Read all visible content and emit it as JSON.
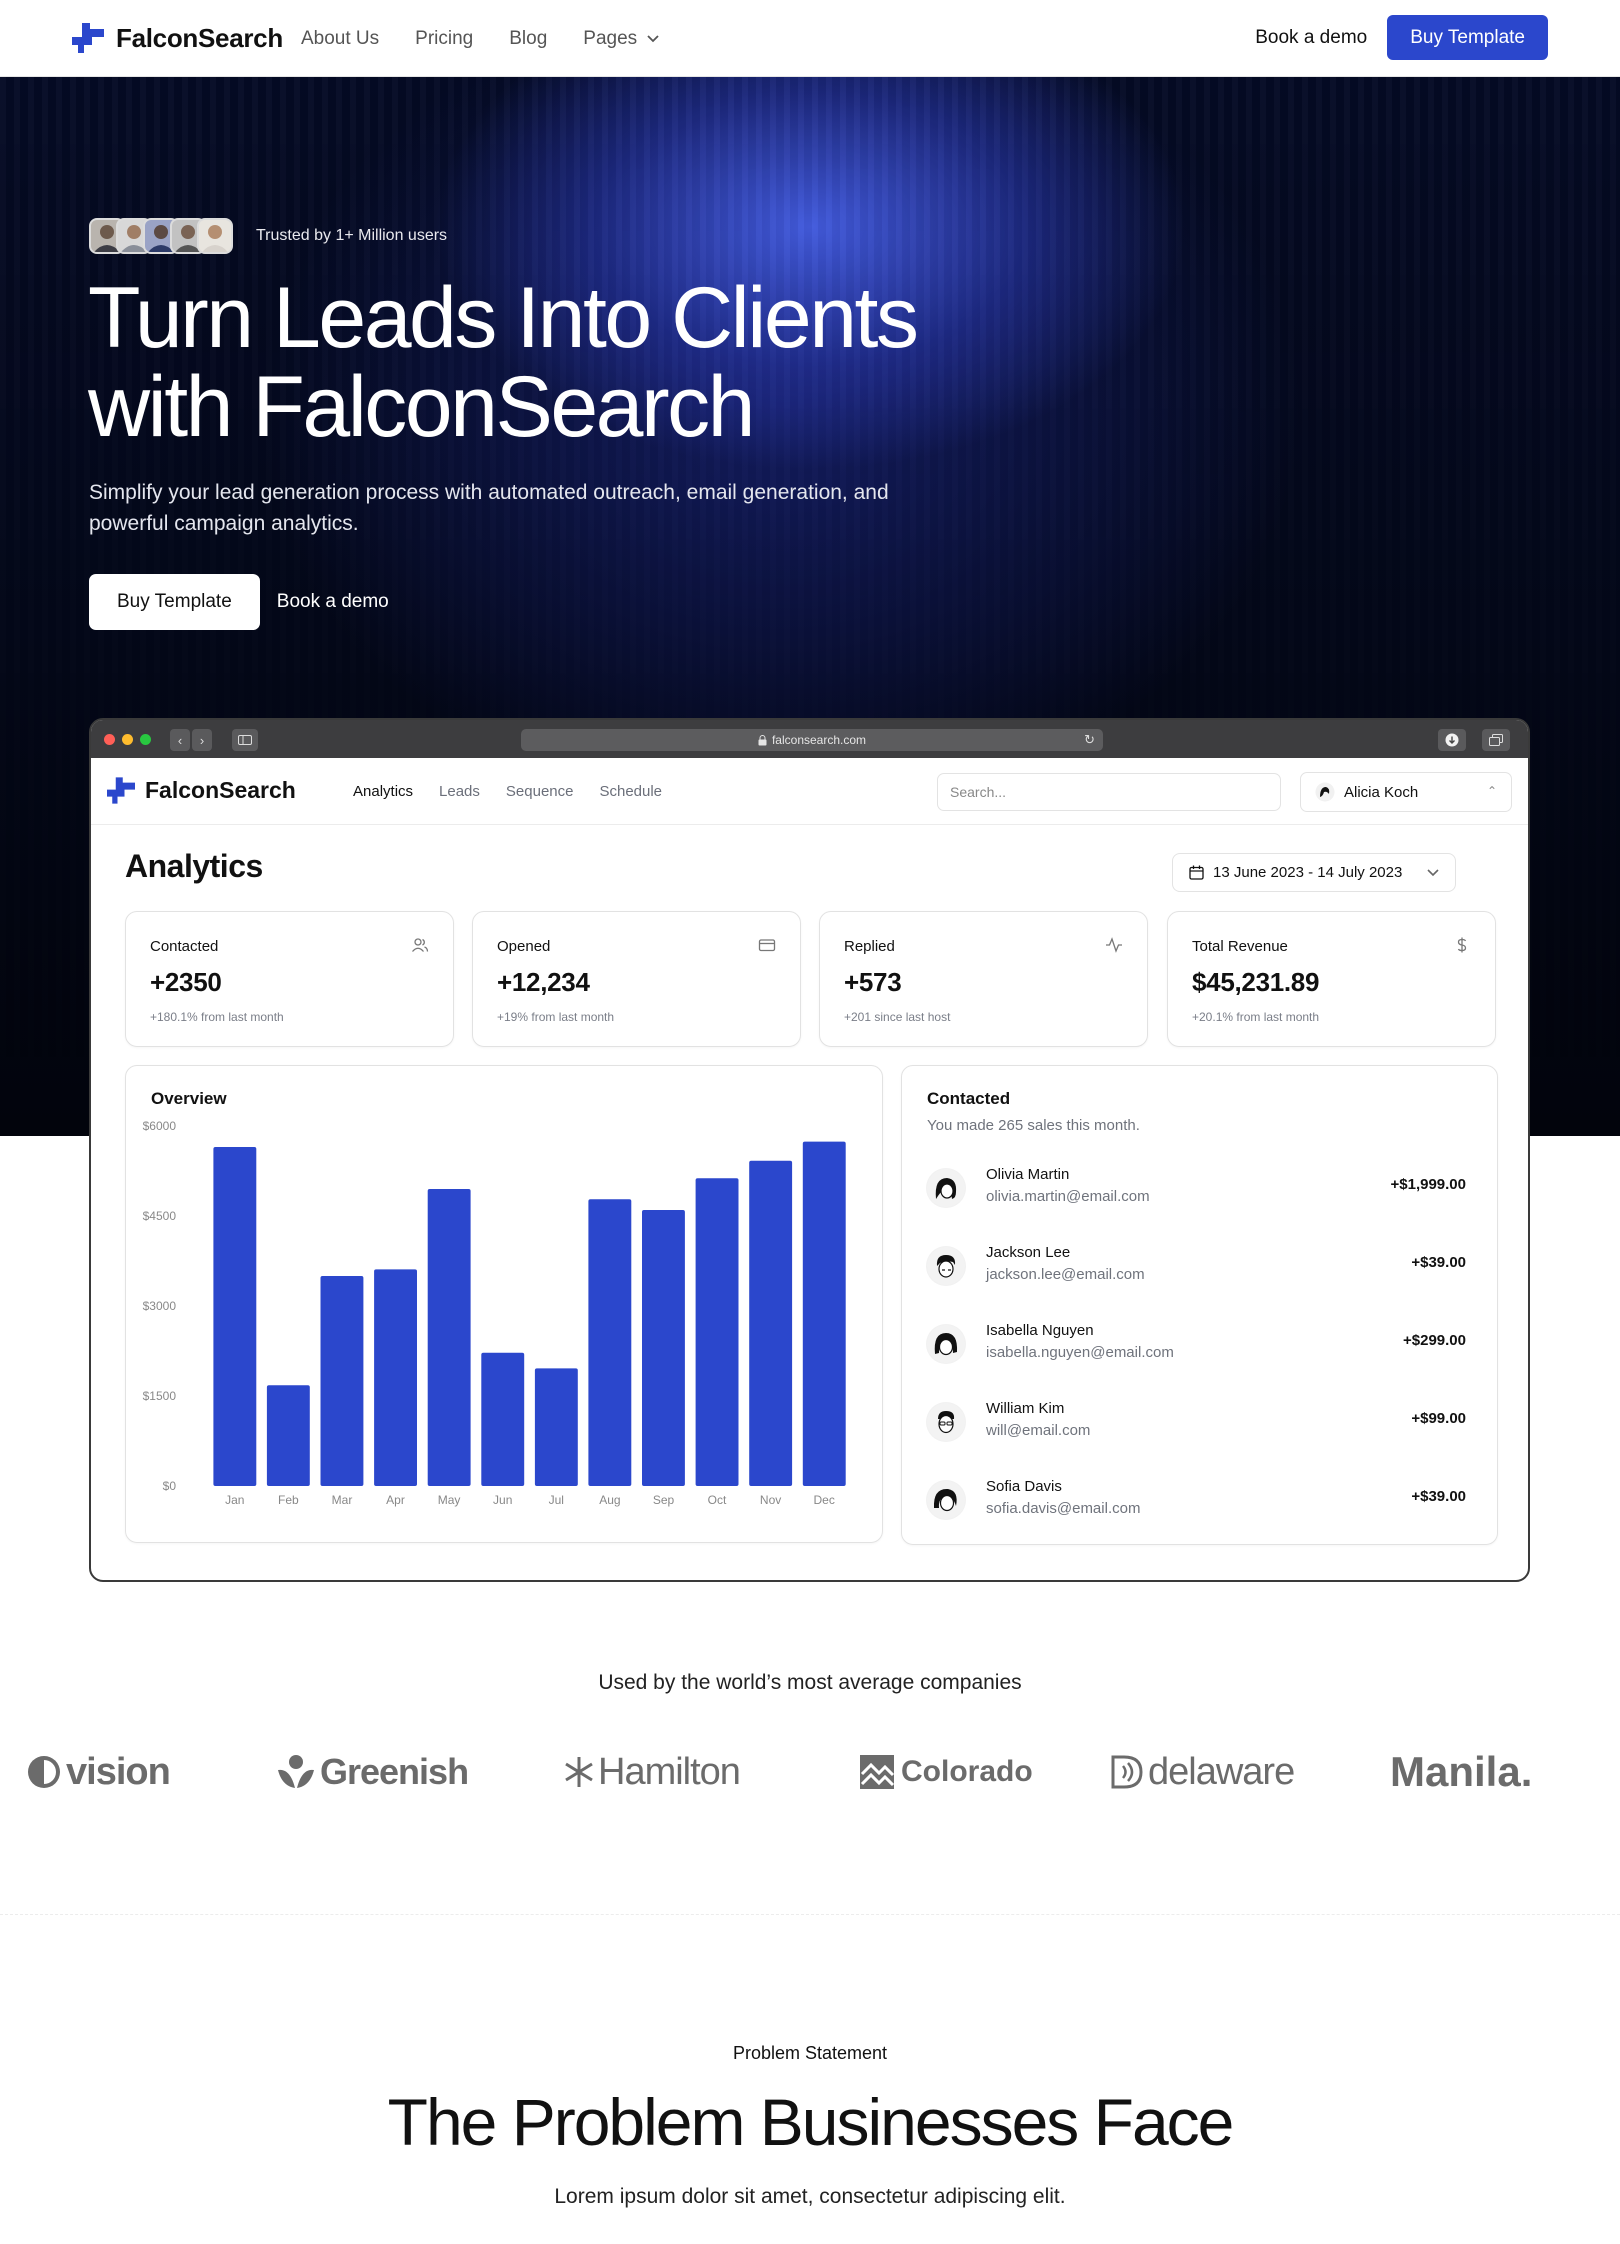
{
  "nav": {
    "brand": "FalconSearch",
    "links": [
      "About Us",
      "Pricing",
      "Blog",
      "Pages"
    ],
    "book_demo": "Book a demo",
    "buy_template": "Buy Template"
  },
  "hero": {
    "trusted_text": "Trusted by 1+ Million users",
    "title_line1": "Turn Leads Into Clients",
    "title_line2": "with FalconSearch",
    "subtitle": "Simplify your lead generation process with automated outreach, email generation, and powerful campaign analytics.",
    "buy_template": "Buy Template",
    "book_demo": "Book a demo"
  },
  "browser": {
    "url": "falconsearch.com"
  },
  "app": {
    "brand": "FalconSearch",
    "tabs": [
      "Analytics",
      "Leads",
      "Sequence",
      "Schedule"
    ],
    "search_placeholder": "Search...",
    "user_name": "Alicia Koch",
    "page_title": "Analytics",
    "date_range": "13 June 2023 - 14 July 2023",
    "stats": [
      {
        "label": "Contacted",
        "value": "+2350",
        "sub": "+180.1% from last month",
        "icon": "users-icon"
      },
      {
        "label": "Opened",
        "value": "+12,234",
        "sub": "+19% from last month",
        "icon": "credit-card-icon"
      },
      {
        "label": "Replied",
        "value": "+573",
        "sub": "+201 since last host",
        "icon": "activity-icon"
      },
      {
        "label": "Total Revenue",
        "value": "$45,231.89",
        "sub": "+20.1% from last month",
        "icon": "dollar-icon"
      }
    ],
    "overview_title": "Overview",
    "contacted_title": "Contacted",
    "contacted_sub": "You made 265 sales this month.",
    "sales": [
      {
        "name": "Olivia Martin",
        "email": "olivia.martin@email.com",
        "amount": "+$1,999.00"
      },
      {
        "name": "Jackson Lee",
        "email": "jackson.lee@email.com",
        "amount": "+$39.00"
      },
      {
        "name": "Isabella Nguyen",
        "email": "isabella.nguyen@email.com",
        "amount": "+$299.00"
      },
      {
        "name": "William Kim",
        "email": "will@email.com",
        "amount": "+$99.00"
      },
      {
        "name": "Sofia Davis",
        "email": "sofia.davis@email.com",
        "amount": "+$39.00"
      }
    ]
  },
  "chart_data": {
    "type": "bar",
    "categories": [
      "Jan",
      "Feb",
      "Mar",
      "Apr",
      "May",
      "Jun",
      "Jul",
      "Aug",
      "Sep",
      "Oct",
      "Nov",
      "Dec"
    ],
    "values": [
      5650,
      1680,
      3500,
      3610,
      4950,
      2220,
      1960,
      4780,
      4600,
      5130,
      5420,
      5740
    ],
    "ytick_labels": [
      "$0",
      "$1500",
      "$3000",
      "$4500",
      "$6000"
    ],
    "ytick_values": [
      0,
      1500,
      3000,
      4500,
      6000
    ],
    "ylim": [
      0,
      6000
    ],
    "bar_color": "#2b47cc"
  },
  "logos": {
    "heading": "Used by the world’s most average companies",
    "items": [
      "vision",
      "Greenish",
      "Hamilton",
      "Colorado",
      "delaware",
      "Manila."
    ]
  },
  "problem": {
    "label": "Problem Statement",
    "title": "The Problem Businesses Face",
    "subtitle": "Lorem ipsum dolor sit amet, consectetur adipiscing elit."
  },
  "colors": {
    "accent": "#2b47cc",
    "hero_bg": "#050b25"
  }
}
